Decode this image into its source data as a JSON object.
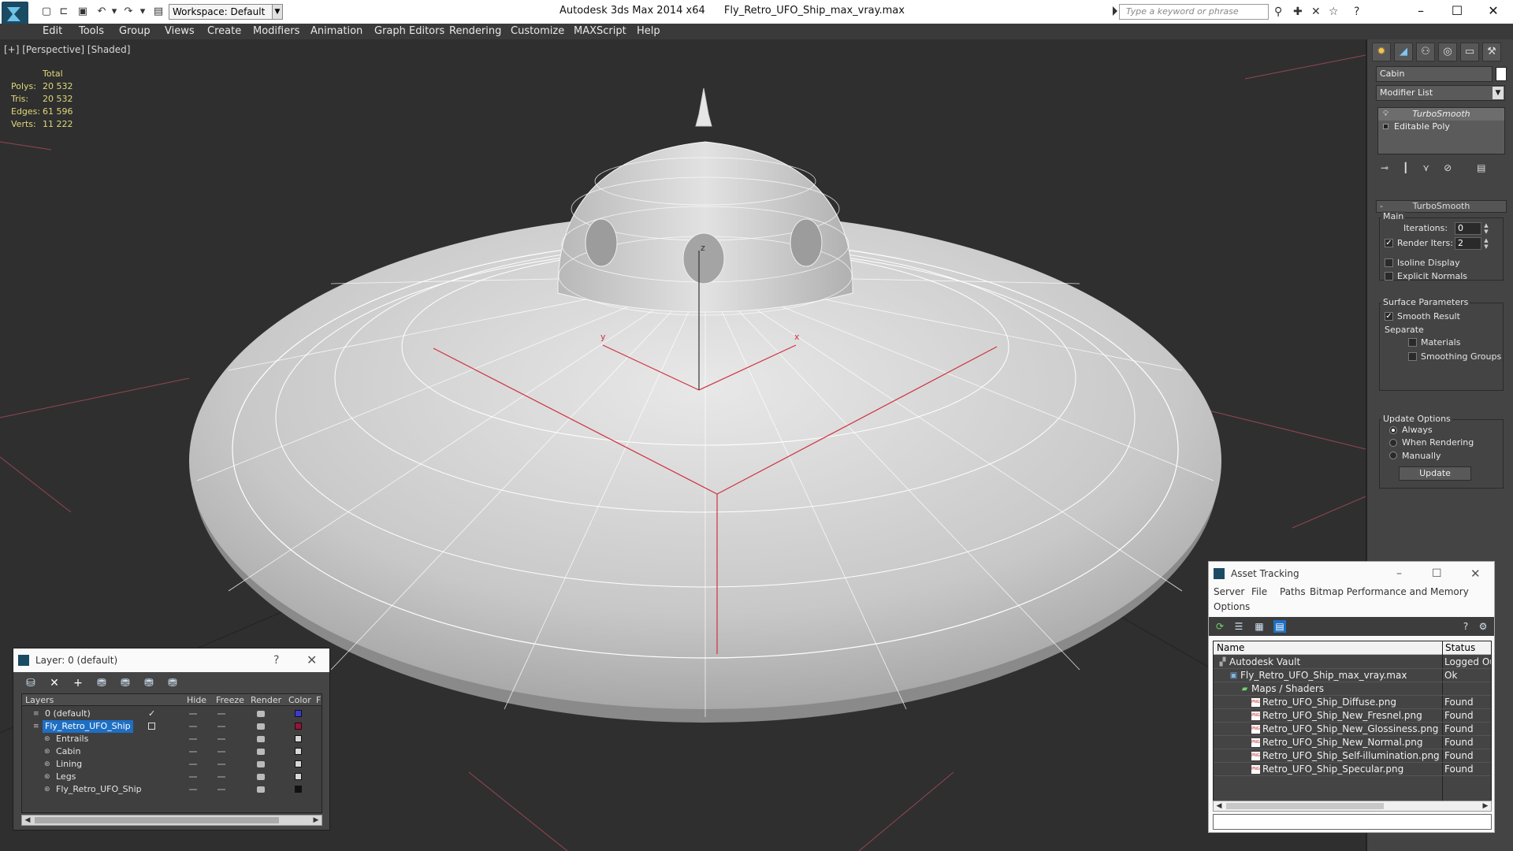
{
  "app": {
    "title": "Autodesk 3ds Max  2014 x64",
    "file": "Fly_Retro_UFO_Ship_max_vray.max",
    "workspace": "Workspace: Default",
    "search_placeholder": "Type a keyword or phrase"
  },
  "menu": [
    "Edit",
    "Tools",
    "Group",
    "Views",
    "Create",
    "Modifiers",
    "Animation",
    "Graph Editors",
    "Rendering",
    "Customize",
    "MAXScript",
    "Help"
  ],
  "viewport": {
    "label": "[+] [Perspective] [Shaded]",
    "stats": {
      "header": "Total",
      "rows": [
        {
          "k": "Polys:",
          "v": "20 532"
        },
        {
          "k": "Tris:",
          "v": "20 532"
        },
        {
          "k": "Edges:",
          "v": "61 596"
        },
        {
          "k": "Verts:",
          "v": "11 222"
        }
      ]
    },
    "axes": {
      "x": "x",
      "y": "y",
      "z": "z"
    }
  },
  "command_panel": {
    "object_name": "Cabin",
    "modifier_list": "Modifier List",
    "stack": [
      "TurboSmooth",
      "Editable Poly"
    ],
    "rollout_title": "TurboSmooth",
    "main_label": "Main",
    "iterations_label": "Iterations:",
    "iterations_value": "0",
    "render_iters_label": "Render Iters:",
    "render_iters_value": "2",
    "isoline_label": "Isoline Display",
    "explicit_normals_label": "Explicit Normals",
    "surface_params_label": "Surface Parameters",
    "smooth_result_label": "Smooth Result",
    "separate_label": "Separate",
    "materials_label": "Materials",
    "smoothing_groups_label": "Smoothing Groups",
    "update_options_label": "Update Options",
    "always_label": "Always",
    "when_rendering_label": "When Rendering",
    "manually_label": "Manually",
    "update_button": "Update"
  },
  "layer_dialog": {
    "title": "Layer: 0 (default)",
    "help": "?",
    "columns": {
      "layers": "Layers",
      "hide": "Hide",
      "freeze": "Freeze",
      "render": "Render",
      "color": "Color",
      "extra": "F"
    },
    "rows": [
      {
        "name": "0 (default)",
        "color": "#3a3ad8"
      },
      {
        "name": "Fly_Retro_UFO_Ship",
        "color": "#a0103a"
      },
      {
        "name": "Entrails",
        "color": "#d8d8d8"
      },
      {
        "name": "Cabin",
        "color": "#d8d8d8"
      },
      {
        "name": "Lining",
        "color": "#d8d8d8"
      },
      {
        "name": "Legs",
        "color": "#d8d8d8"
      },
      {
        "name": "Fly_Retro_UFO_Ship",
        "color": "#111111"
      }
    ]
  },
  "asset_dialog": {
    "title": "Asset Tracking",
    "menu": [
      "Server",
      "File",
      "Paths",
      "Bitmap Performance and Memory",
      "Options"
    ],
    "columns": {
      "name": "Name",
      "status": "Status"
    },
    "rows": [
      {
        "name": "Autodesk Vault",
        "status": "Logged Ou"
      },
      {
        "name": "Fly_Retro_UFO_Ship_max_vray.max",
        "status": "Ok"
      },
      {
        "name": "Maps / Shaders",
        "status": ""
      },
      {
        "name": "Retro_UFO_Ship_Diffuse.png",
        "status": "Found"
      },
      {
        "name": "Retro_UFO_Ship_New_Fresnel.png",
        "status": "Found"
      },
      {
        "name": "Retro_UFO_Ship_New_Glossiness.png",
        "status": "Found"
      },
      {
        "name": "Retro_UFO_Ship_New_Normal.png",
        "status": "Found"
      },
      {
        "name": "Retro_UFO_Ship_Self-illumination.png",
        "status": "Found"
      },
      {
        "name": "Retro_UFO_Ship_Specular.png",
        "status": "Found"
      }
    ]
  },
  "colors": {
    "accent": "#1e6fc4",
    "stats": "#e0d87a",
    "axis": "#d03040"
  }
}
